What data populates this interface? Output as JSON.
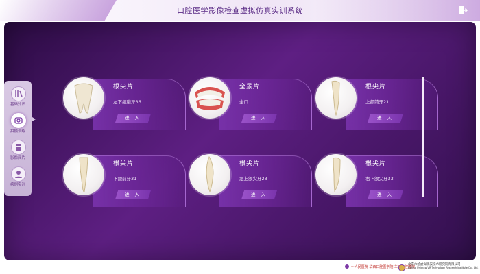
{
  "header": {
    "title": "口腔医学影像检查虚拟仿真实训系统",
    "exit_icon": "exit-icon"
  },
  "sidebar": {
    "items": [
      {
        "label": "基础知识",
        "icon": "book-icon",
        "active": false
      },
      {
        "label": "拍摄训练",
        "icon": "camera-icon",
        "active": true
      },
      {
        "label": "影像阅片",
        "icon": "film-icon",
        "active": false
      },
      {
        "label": "病例实训",
        "icon": "case-icon",
        "active": false
      }
    ]
  },
  "cards": [
    {
      "title": "根尖片",
      "subtitle": "左下颌磨牙36",
      "button": "进 入",
      "image": "molar-tooth-image"
    },
    {
      "title": "全景片",
      "subtitle": "全口",
      "button": "进 入",
      "image": "full-mouth-model-image"
    },
    {
      "title": "根尖片",
      "subtitle": "上颌前牙21",
      "button": "进 入",
      "image": "incisor-tooth-image"
    },
    {
      "title": "根尖片",
      "subtitle": "下颌前牙31",
      "button": "进 入",
      "image": "incisor-tooth-image"
    },
    {
      "title": "根尖片",
      "subtitle": "左上颌尖牙23",
      "button": "进 入",
      "image": "canine-tooth-image"
    },
    {
      "title": "根尖片",
      "subtitle": "右下颌尖牙33",
      "button": "进 入",
      "image": "canine-tooth-image"
    }
  ],
  "footer": {
    "org1": "···人民医院 华西口腔医学院 华西口腔医院",
    "org2": "北京众绘虚拟现实技术研究院有限公司",
    "org2_en": "Beijing Unidraw VR Technology Research Institute Co., Ltd."
  },
  "colors": {
    "accent": "#5b2c86",
    "stage": "#4a1a6b",
    "button": "#8a44bb"
  }
}
